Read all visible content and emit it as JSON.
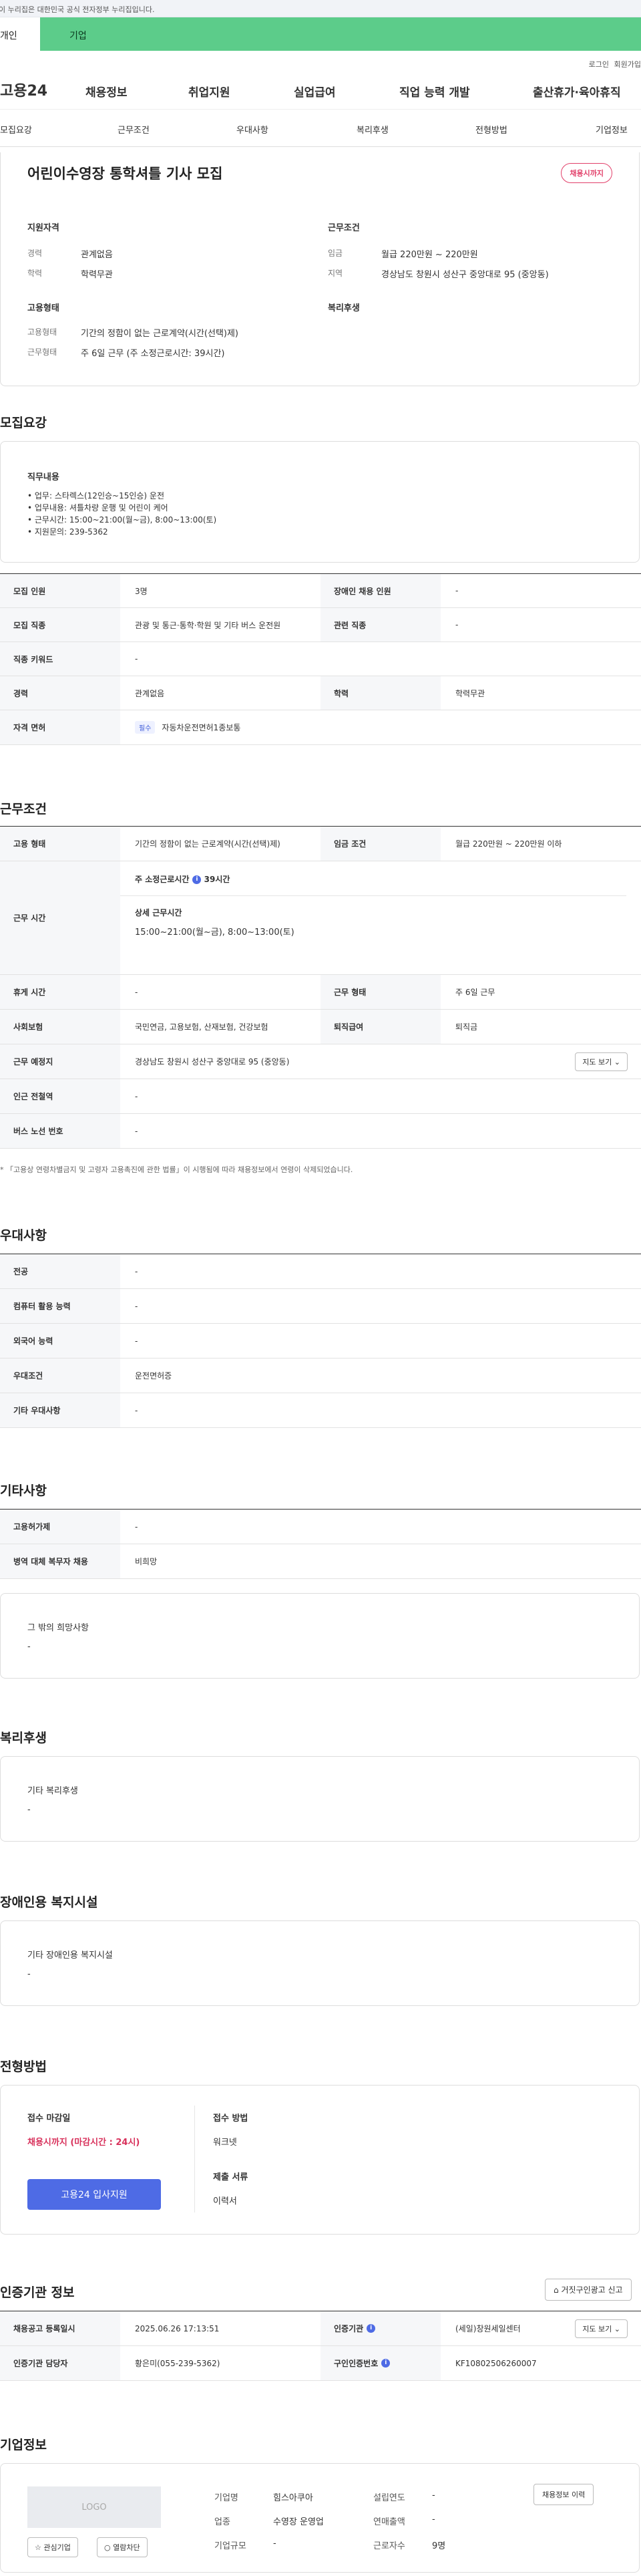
{
  "gov_banner": "이 누리집은 대한민국 공식 전자정부 누리집입니다.",
  "user_tabs": {
    "individual": "개인",
    "company": "기업"
  },
  "util": {
    "login": "로그인",
    "join": "회원가입"
  },
  "logo": "고용24",
  "gnb": [
    "채용정보",
    "취업지원",
    "실업급여",
    "직업 능력 개발",
    "출산휴가·육아휴직"
  ],
  "anchors": [
    "모집요강",
    "근무조건",
    "우대사항",
    "복리후생",
    "전형방법",
    "기업정보"
  ],
  "job": {
    "title": "어린이수영장 통학셔틀 기사 모집",
    "deadline_badge": "채용시까지",
    "summary": {
      "qual_h": "지원자격",
      "exp_k": "경력",
      "exp_v": "관계없음",
      "edu_k": "학력",
      "edu_v": "학력무관",
      "emp_h": "고용형태",
      "type_k": "고용형태",
      "type_v": "기간의 정함이 없는 근로계약(시간(선택)제)",
      "hours_k": "근무형태",
      "hours_v": "주 6일 근무 (주 소정근로시간: 39시간)",
      "cond_h": "근무조건",
      "wage_k": "임금",
      "wage_v": "월급 220만원 ~ 220만원",
      "region_k": "지역",
      "region_v": "경상남도 창원시 성산구 중앙대로 95 (중앙동)",
      "welfare_h": "복리후생"
    }
  },
  "recruit": {
    "title": "모집요강",
    "duty_h": "직무내용",
    "duty_lines": [
      "• 업무: 스타렉스(12인승~15인승) 운전",
      "• 업무내용: 셔틀차량 운행 및 어린이 케어",
      "• 근무시간: 15:00~21:00(월~금),  8:00~13:00(토)",
      "• 지원문의: 239-5362"
    ],
    "rows": {
      "count_k": "모집 인원",
      "count_v": "3명",
      "disabled_k": "장애인 채용 인원",
      "disabled_v": "-",
      "job_k": "모집 직종",
      "job_v": "관광 및 통근·통학·학원 및 기타 버스 운전원",
      "related_k": "관련 직종",
      "related_v": "-",
      "kw_k": "직종 키워드",
      "kw_v": "-",
      "exp_k": "경력",
      "exp_v": "관계없음",
      "edu_k": "학력",
      "edu_v": "학력무관",
      "lic_k": "자격 면허",
      "lic_tag": "필수",
      "lic_v": "자동차운전면허1종보통"
    }
  },
  "work": {
    "title": "근무조건",
    "type_k": "고용 형태",
    "type_v": "기간의 정함이 없는 근로계약(시간(선택)제)",
    "wage_k": "임금 조건",
    "wage_v": "월급 220만원 ~ 220만원 이하",
    "time_k": "근무 시간",
    "weekly_label": "주 소정근로시간",
    "weekly_v": "39시간",
    "detail_label": "상세 근무시간",
    "detail_v": "15:00~21:00(월~금),  8:00~13:00(토)",
    "rest_k": "휴게 시간",
    "rest_v": "-",
    "form_k": "근무 형태",
    "form_v": "주 6일 근무",
    "ins_k": "사회보험",
    "ins_v": "국민연금, 고용보험, 산재보험, 건강보험",
    "sev_k": "퇴직급여",
    "sev_v": "퇴직금",
    "loc_k": "근무 예정지",
    "loc_v": "경상남도 창원시 성산구 중앙대로 95 (중앙동)",
    "map_btn": "지도 보기",
    "sub_k": "인근 전철역",
    "sub_v": "-",
    "bus_k": "버스 노선 번호",
    "bus_v": "-",
    "note": "* 「고용상 연령차별금지 및 고령자 고용촉진에 관한 법률」이 시행됨에 따라 채용정보에서 연령이 삭제되었습니다."
  },
  "pref": {
    "title": "우대사항",
    "major_k": "전공",
    "major_v": "-",
    "pc_k": "컴퓨터 활용 능력",
    "pc_v": "-",
    "lang_k": "외국어 능력",
    "lang_v": "-",
    "cond_k": "우대조건",
    "cond_v": "운전면허증",
    "etc_k": "기타 우대사항",
    "etc_v": "-"
  },
  "etc": {
    "title": "기타사항",
    "permit_k": "고용허가제",
    "permit_v": "-",
    "mil_k": "병역 대체 복무자 채용",
    "mil_v": "비희망",
    "wish_h": "그 밖의 희망사항",
    "wish_v": "-"
  },
  "welfare": {
    "title": "복리후생",
    "h": "기타 복리후생",
    "v": "-"
  },
  "facility": {
    "title": "장애인용 복지시설",
    "h": "기타 장애인용 복지시설",
    "v": "-"
  },
  "process": {
    "title": "전형방법",
    "deadline_h": "접수 마감일",
    "deadline_v": "채용시까지 (마감시간 : 24시)",
    "apply_btn": "고용24 입사지원",
    "method_h": "접수 방법",
    "method_v": "워크넷",
    "docs_h": "제출 서류",
    "docs_v": "이력서"
  },
  "agency": {
    "title": "인증기관 정보",
    "report_btn": "거짓구인광고 신고",
    "reg_k": "채용공고 등록일시",
    "reg_v": "2025.06.26 17:13:51",
    "org_k": "인증기관",
    "org_v": "(세일)창원세일센터",
    "map_btn": "지도 보기",
    "mgr_k": "인증기관 담당자",
    "mgr_v": "황은미(055-239-5362)",
    "id_k": "구인인증번호",
    "id_v": "KF10802506260007"
  },
  "company": {
    "title": "기업정보",
    "logo": "LOGO",
    "fav_btn": "관심기업",
    "follow_btn": "열람차단",
    "history_btn": "채용정보 이력",
    "name_k": "기업명",
    "name_v": "힘스아쿠아",
    "ind_k": "업종",
    "ind_v": "수영장 운영업",
    "size_k": "기업규모",
    "size_v": "-",
    "year_k": "설립연도",
    "year_v": "-",
    "sales_k": "연매출액",
    "sales_v": "-",
    "emp_k": "근로자수",
    "emp_v": "9명"
  }
}
